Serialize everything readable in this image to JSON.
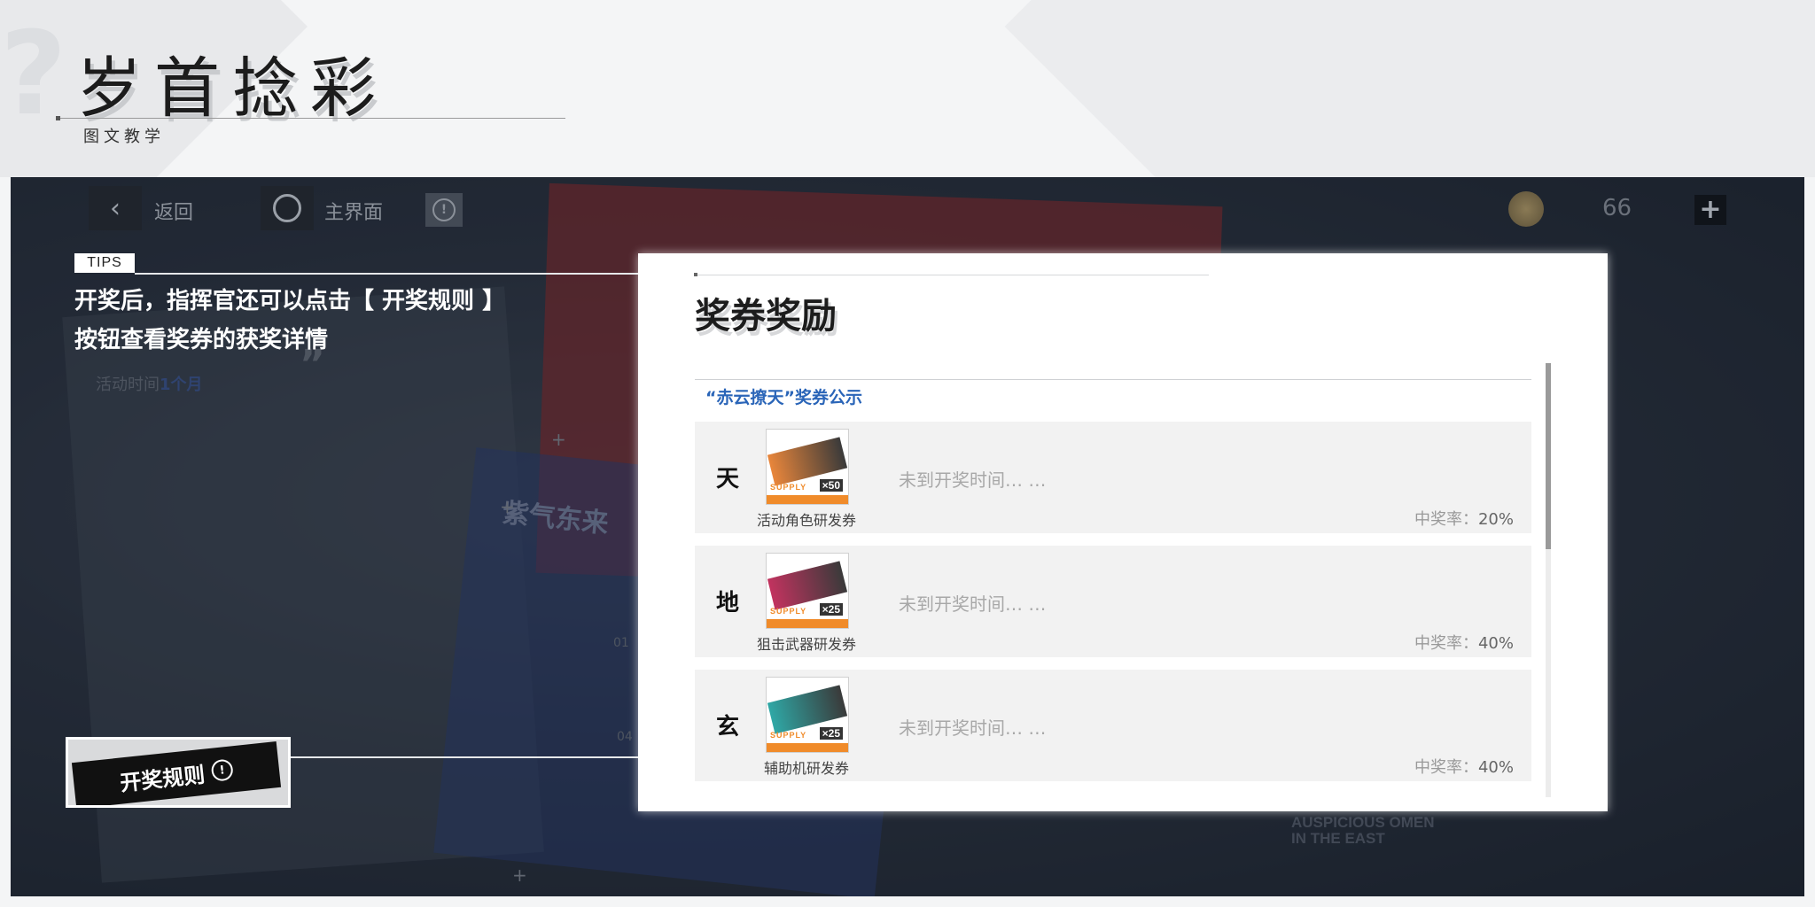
{
  "header": {
    "title": "岁首捻彩",
    "subtitle": "图文教学"
  },
  "game": {
    "nav": {
      "back_label": "返回",
      "home_label": "主界面",
      "info_glyph": "!"
    },
    "currency": {
      "count": "66",
      "plus_glyph": "+"
    },
    "background": {
      "activity_time_label": "活动时间",
      "activity_time_value": "1个月",
      "card_text": "紫气东来",
      "quote_mark": "”",
      "num_1": "01",
      "num_2": "04",
      "east_line1": "AUSPICIOUS OMEN",
      "east_line2": "IN THE EAST"
    }
  },
  "tips": {
    "badge": "TIPS",
    "line1": "开奖后，指挥官还可以点击【 开奖规则 】",
    "line2": "按钮查看奖券的获奖详情"
  },
  "rule_button": {
    "label": "开奖规则",
    "icon_glyph": "!"
  },
  "panel": {
    "title": "奖券奖励",
    "section_title": "“赤云撩天”奖券公示",
    "scroll_position": 0.0,
    "rows": [
      {
        "tier": "天",
        "ticket_name": "活动角色研发券",
        "status": "未到开奖时间… …",
        "rate_label": "中奖率：",
        "rate_value": "20%",
        "qty": "×50",
        "supply": "SUPPLY",
        "band_color": "#e9863b"
      },
      {
        "tier": "地",
        "ticket_name": "狙击武器研发券",
        "status": "未到开奖时间… …",
        "rate_label": "中奖率：",
        "rate_value": "40%",
        "qty": "×25",
        "supply": "SUPPLY",
        "band_color": "#c2335f"
      },
      {
        "tier": "玄",
        "ticket_name": "辅助机研发券",
        "status": "未到开奖时间… …",
        "rate_label": "中奖率：",
        "rate_value": "40%",
        "qty": "×25",
        "supply": "SUPPLY",
        "band_color": "#2fa8a6"
      }
    ]
  }
}
